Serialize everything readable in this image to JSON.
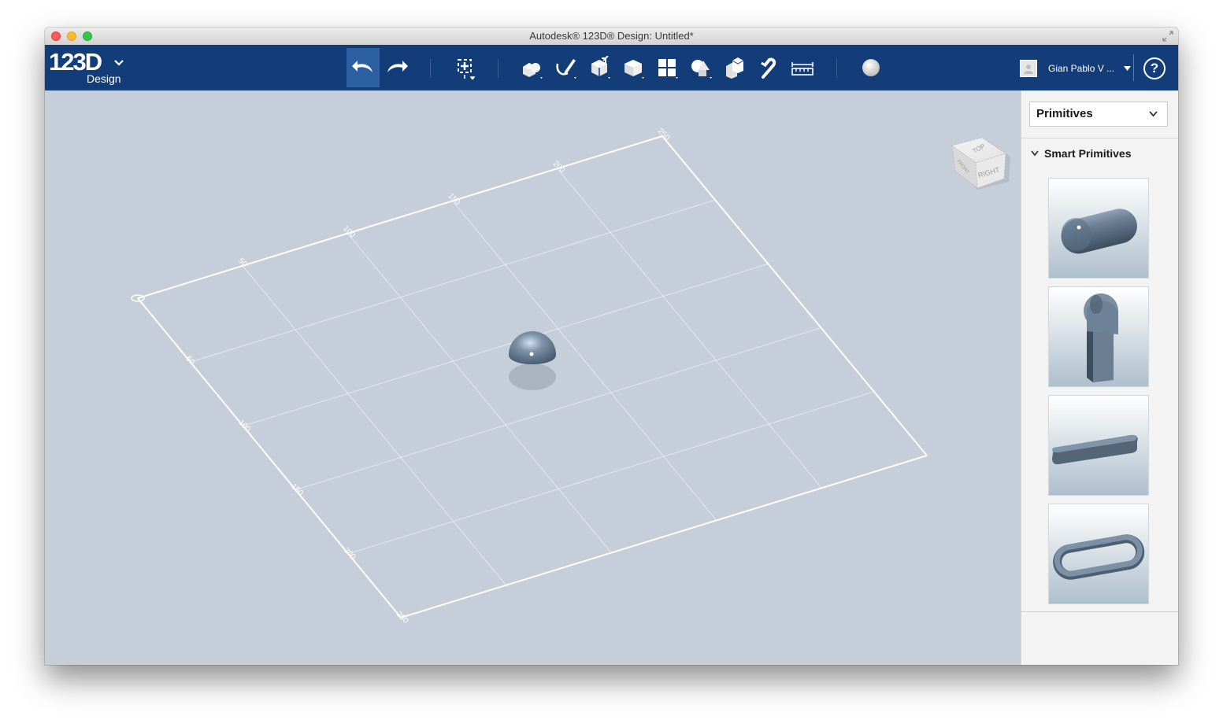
{
  "window": {
    "title": "Autodesk® 123D® Design: Untitled*"
  },
  "logo": {
    "main": "123D",
    "sub": "Design"
  },
  "toolbar": {
    "tools": [
      {
        "name": "undo-icon",
        "active": true
      },
      {
        "name": "redo-icon",
        "active": false
      },
      {
        "name": "transform-icon",
        "active": false
      },
      {
        "name": "primitives-icon",
        "active": false
      },
      {
        "name": "sketch-icon",
        "active": false
      },
      {
        "name": "construct-icon",
        "active": false
      },
      {
        "name": "modify-icon",
        "active": false
      },
      {
        "name": "pattern-icon",
        "active": false
      },
      {
        "name": "grouping-icon",
        "active": false
      },
      {
        "name": "combine-icon",
        "active": false
      },
      {
        "name": "snap-icon",
        "active": false
      },
      {
        "name": "measure-icon",
        "active": false
      },
      {
        "name": "material-icon",
        "active": false
      }
    ]
  },
  "user": {
    "name": "Gian Pablo V ..."
  },
  "help": {
    "label": "?"
  },
  "viewcube": {
    "top_label": "TOP",
    "right_label": "RIGHT",
    "front_label": "FRONT"
  },
  "grid": {
    "back_edge_labels": [
      "50",
      "100",
      "150",
      "200",
      "250"
    ],
    "left_edge_labels": [
      "50",
      "100",
      "150",
      "200",
      "250"
    ]
  },
  "panel": {
    "dropdown_value": "Primitives",
    "section_title": "Smart Primitives",
    "items": [
      {
        "name": "capsule"
      },
      {
        "name": "keyhole-extrusion"
      },
      {
        "name": "slot-bar"
      },
      {
        "name": "rounded-loop"
      }
    ]
  },
  "colors": {
    "toolbar_bg": "#133d78",
    "viewport_bg": "#c5ced9",
    "active_tool": "#2d5fa3"
  }
}
